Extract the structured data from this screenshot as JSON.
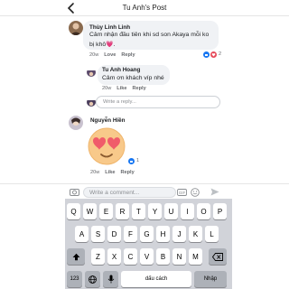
{
  "header": {
    "title": "Tu Anh's Post"
  },
  "comments": [
    {
      "author": "Thùy Linh Linh",
      "text_line1": "Cảm nhận đầu tiên khi sd son Akaya mỗi ko",
      "text_line2": "bị khô💗.",
      "time": "20w",
      "reaction_label": "Love",
      "reply_label": "Reply",
      "reaction_count": "2"
    },
    {
      "author": "Tu Anh Hoang",
      "text": "Cảm ơn khách víp nhé",
      "time": "20w",
      "like_label": "Like",
      "reply_label": "Reply"
    },
    {
      "author": "Nguyễn Hiền",
      "time": "20w",
      "like_label": "Like",
      "reply_label": "Reply",
      "reaction_count": "1"
    }
  ],
  "reply_box": {
    "placeholder": "Write a reply..."
  },
  "composer": {
    "placeholder": "Write a comment..."
  },
  "keyboard": {
    "row1": [
      "Q",
      "W",
      "E",
      "R",
      "T",
      "Y",
      "U",
      "I",
      "O",
      "P"
    ],
    "row2": [
      "A",
      "S",
      "D",
      "F",
      "G",
      "H",
      "J",
      "K",
      "L"
    ],
    "row3": [
      "Z",
      "X",
      "C",
      "V",
      "B",
      "N",
      "M"
    ],
    "numbers_label": "123",
    "space_label": "dấu cách",
    "return_label": "Nhập"
  },
  "colors": {
    "accent": "#1877f2",
    "love": "#e64a5a",
    "keyboard_bg": "#d1d3d9"
  }
}
